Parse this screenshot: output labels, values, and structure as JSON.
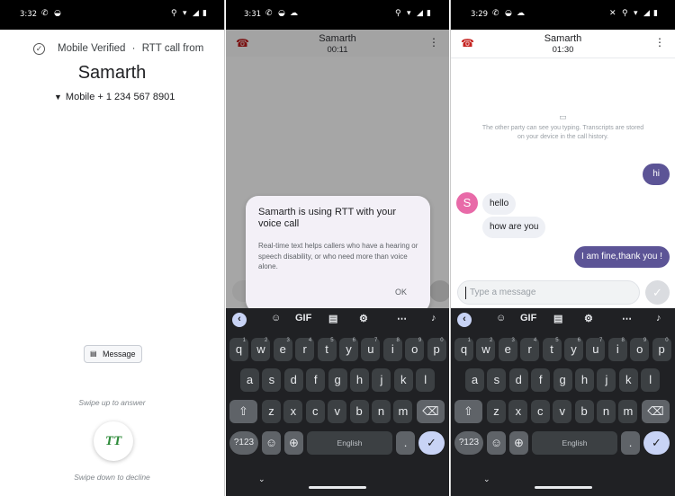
{
  "panel1": {
    "status": {
      "time": "3:32"
    },
    "verified_text": "Mobile Verified",
    "separator": "·",
    "rtt_text": "RTT call from",
    "caller_name": "Samarth",
    "caller_number": "Mobile + 1 234 567 8901",
    "message_button": "Message",
    "swipe_up": "Swipe up to answer",
    "swipe_down": "Swipe down to decline",
    "answer_glyph": "TT"
  },
  "panel2": {
    "status": {
      "time": "3:31"
    },
    "call_name": "Samarth",
    "call_duration": "00:11",
    "dialog": {
      "title": "Samarth  is using RTT with your voice call",
      "body": "Real-time text helps callers who have a hearing or speech disability, or who need more than voice alone.",
      "ok": "OK"
    }
  },
  "panel3": {
    "status": {
      "time": "3:29"
    },
    "call_name": "Samarth",
    "call_duration": "01:30",
    "notice": "The other party can see you typing. Transcripts are stored on your device in the call history.",
    "avatar_letter": "S",
    "messages": [
      {
        "from": "me",
        "text": "hi"
      },
      {
        "from": "them",
        "text": "hello"
      },
      {
        "from": "them",
        "text": "how are you"
      },
      {
        "from": "me",
        "text": "I am fine,thank you !"
      }
    ],
    "input_placeholder": "Type a message"
  },
  "keyboard": {
    "toolbar_gif": "GIF",
    "row1": [
      "q",
      "w",
      "e",
      "r",
      "t",
      "y",
      "u",
      "i",
      "o",
      "p"
    ],
    "row1_hints": [
      "1",
      "2",
      "3",
      "4",
      "5",
      "6",
      "7",
      "8",
      "9",
      "0"
    ],
    "row2": [
      "a",
      "s",
      "d",
      "f",
      "g",
      "h",
      "j",
      "k",
      "l"
    ],
    "row3": [
      "z",
      "x",
      "c",
      "v",
      "b",
      "n",
      "m"
    ],
    "sym": "?123",
    "space": "English",
    "period": ".",
    "comma": ","
  },
  "colors": {
    "accent": "#5c5496",
    "avatar": "#e86aa8",
    "incoming_bubble": "#eef0f5",
    "end_call_red": "#c5221f",
    "answer_green": "#2e8b3a"
  }
}
